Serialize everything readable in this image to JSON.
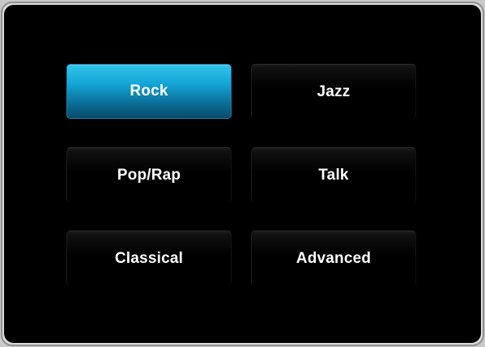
{
  "presets": [
    {
      "label": "Rock",
      "selected": true
    },
    {
      "label": "Jazz",
      "selected": false
    },
    {
      "label": "Pop/Rap",
      "selected": false
    },
    {
      "label": "Talk",
      "selected": false
    },
    {
      "label": "Classical",
      "selected": false
    },
    {
      "label": "Advanced",
      "selected": false
    }
  ],
  "colors": {
    "accent": "#14a6d6",
    "background": "#000000",
    "text": "#ffffff"
  }
}
